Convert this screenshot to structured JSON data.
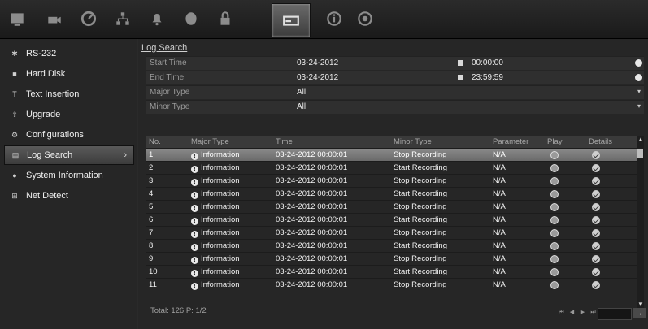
{
  "topbar": {
    "icons": [
      "monitor-icon",
      "camera-icon",
      "gauge-icon",
      "network-icon",
      "bell-icon",
      "disk-icon",
      "lock-icon",
      "device-icon",
      "info-icon",
      "power-icon"
    ]
  },
  "sidebar": {
    "items": [
      {
        "label": "RS-232",
        "icon": "serial-icon"
      },
      {
        "label": "Hard Disk",
        "icon": "harddisk-icon"
      },
      {
        "label": "Text Insertion",
        "icon": "text-icon"
      },
      {
        "label": "Upgrade",
        "icon": "upgrade-icon"
      },
      {
        "label": "Configurations",
        "icon": "config-icon"
      },
      {
        "label": "Log Search",
        "icon": "log-icon",
        "active": true
      },
      {
        "label": "System Information",
        "icon": "sysinfo-icon"
      },
      {
        "label": "Net Detect",
        "icon": "netdetect-icon"
      }
    ]
  },
  "page": {
    "title": "Log Search"
  },
  "form": {
    "start_label": "Start Time",
    "start_date": "03-24-2012",
    "start_time": "00:00:00",
    "end_label": "End Time",
    "end_date": "03-24-2012",
    "end_time": "23:59:59",
    "major_label": "Major Type",
    "major_value": "All",
    "minor_label": "Minor Type",
    "minor_value": "All"
  },
  "table": {
    "headers": [
      "No.",
      "Major Type",
      "Time",
      "Minor Type",
      "Parameter",
      "Play",
      "Details"
    ],
    "rows": [
      {
        "no": "1",
        "major": "Information",
        "time": "03-24-2012 00:00:01",
        "minor": "Stop Recording",
        "param": "N/A"
      },
      {
        "no": "2",
        "major": "Information",
        "time": "03-24-2012 00:00:01",
        "minor": "Start Recording",
        "param": "N/A"
      },
      {
        "no": "3",
        "major": "Information",
        "time": "03-24-2012 00:00:01",
        "minor": "Stop Recording",
        "param": "N/A"
      },
      {
        "no": "4",
        "major": "Information",
        "time": "03-24-2012 00:00:01",
        "minor": "Start Recording",
        "param": "N/A"
      },
      {
        "no": "5",
        "major": "Information",
        "time": "03-24-2012 00:00:01",
        "minor": "Stop Recording",
        "param": "N/A"
      },
      {
        "no": "6",
        "major": "Information",
        "time": "03-24-2012 00:00:01",
        "minor": "Start Recording",
        "param": "N/A"
      },
      {
        "no": "7",
        "major": "Information",
        "time": "03-24-2012 00:00:01",
        "minor": "Stop Recording",
        "param": "N/A"
      },
      {
        "no": "8",
        "major": "Information",
        "time": "03-24-2012 00:00:01",
        "minor": "Start Recording",
        "param": "N/A"
      },
      {
        "no": "9",
        "major": "Information",
        "time": "03-24-2012 00:00:01",
        "minor": "Stop Recording",
        "param": "N/A"
      },
      {
        "no": "10",
        "major": "Information",
        "time": "03-24-2012 00:00:01",
        "minor": "Start Recording",
        "param": "N/A"
      },
      {
        "no": "11",
        "major": "Information",
        "time": "03-24-2012 00:00:01",
        "minor": "Stop Recording",
        "param": "N/A"
      }
    ]
  },
  "footer": {
    "total": "Total: 126  P: 1/2",
    "go": "→"
  }
}
